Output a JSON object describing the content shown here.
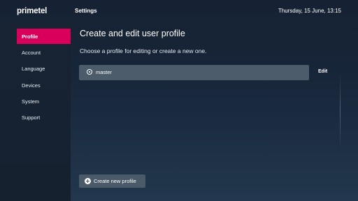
{
  "header": {
    "logo": "primetel",
    "title": "Settings",
    "datetime": "Thursday, 15 June, 13:15"
  },
  "sidebar": {
    "items": [
      {
        "label": "Profile",
        "active": true
      },
      {
        "label": "Account"
      },
      {
        "label": "Language"
      },
      {
        "label": "Devices"
      },
      {
        "label": "System"
      },
      {
        "label": "Support"
      }
    ]
  },
  "main": {
    "heading": "Create and edit user profile",
    "subheading": "Choose a profile for editing or create a new one.",
    "profiles": [
      {
        "name": "master",
        "selected": true
      }
    ],
    "edit_label": "Edit",
    "create_label": "Create new profile"
  },
  "colors": {
    "accent": "#d9005b",
    "row_background": "#4c5c6b"
  }
}
